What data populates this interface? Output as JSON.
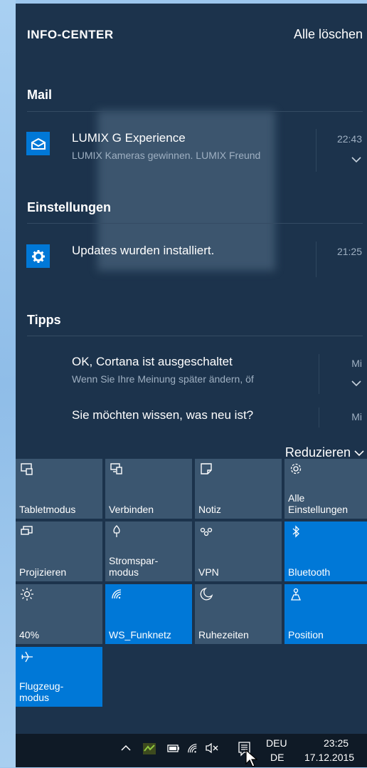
{
  "header": {
    "title": "INFO-CENTER",
    "clear_all": "Alle löschen"
  },
  "groups": [
    {
      "name": "Mail",
      "items": [
        {
          "icon": "mail-icon",
          "title": "LUMIX G Experience",
          "body": "LUMIX Kameras gewinnen. LUMIX Freund",
          "time": "22:43",
          "expandable": true
        }
      ]
    },
    {
      "name": "Einstellungen",
      "items": [
        {
          "icon": "gear-icon",
          "title": "Updates wurden installiert.",
          "body": "",
          "time": "21:25",
          "expandable": false
        }
      ]
    },
    {
      "name": "Tipps",
      "items": [
        {
          "icon": "",
          "title": "OK, Cortana ist ausgeschaltet",
          "body": "Wenn Sie Ihre Meinung später ändern, öf",
          "time": "Mi",
          "expandable": true
        },
        {
          "icon": "",
          "title": "Sie möchten wissen, was neu ist?",
          "body": "",
          "time": "Mi",
          "expandable": false
        }
      ]
    }
  ],
  "collapse_label": "Reduzieren",
  "quick_actions": [
    {
      "label": "Tabletmodus",
      "icon": "tablet-mode-icon",
      "active": false
    },
    {
      "label": "Verbinden",
      "icon": "connect-icon",
      "active": false
    },
    {
      "label": "Notiz",
      "icon": "note-icon",
      "active": false
    },
    {
      "label": "Alle\nEinstellungen",
      "icon": "gear-icon",
      "active": false
    },
    {
      "label": "Projizieren",
      "icon": "project-icon",
      "active": false
    },
    {
      "label": "Stromspar-\nmodus",
      "icon": "battery-saver-icon",
      "active": false
    },
    {
      "label": "VPN",
      "icon": "vpn-icon",
      "active": false
    },
    {
      "label": "Bluetooth",
      "icon": "bluetooth-icon",
      "active": true
    },
    {
      "label": "40%",
      "icon": "brightness-icon",
      "active": false
    },
    {
      "label": "WS_Funknetz",
      "icon": "wifi-icon",
      "active": true
    },
    {
      "label": "Ruhezeiten",
      "icon": "moon-icon",
      "active": false
    },
    {
      "label": "Position",
      "icon": "location-icon",
      "active": true
    },
    {
      "label": "Flugzeug-\nmodus",
      "icon": "airplane-icon",
      "active": true
    }
  ],
  "taskbar": {
    "language_top": "DEU",
    "language_bottom": "DE",
    "time": "23:25",
    "date": "17.12.2015"
  }
}
